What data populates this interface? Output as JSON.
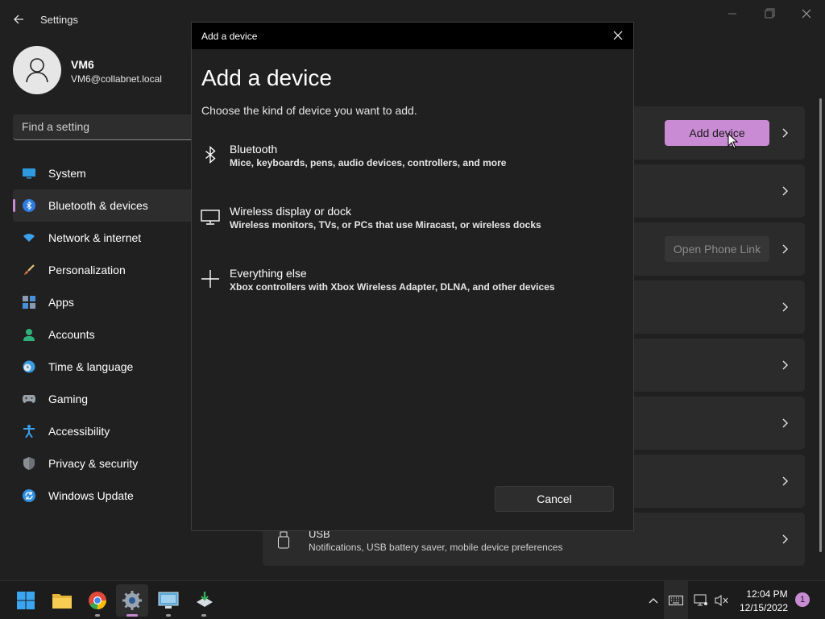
{
  "window": {
    "title": "Settings"
  },
  "profile": {
    "name": "VM6",
    "email": "VM6@collabnet.local"
  },
  "search": {
    "placeholder": "Find a setting"
  },
  "nav": {
    "items": [
      {
        "label": "System",
        "icon": "system-icon",
        "active": false
      },
      {
        "label": "Bluetooth & devices",
        "icon": "bluetooth-icon",
        "active": true
      },
      {
        "label": "Network & internet",
        "icon": "wifi-icon",
        "active": false
      },
      {
        "label": "Personalization",
        "icon": "brush-icon",
        "active": false
      },
      {
        "label": "Apps",
        "icon": "apps-icon",
        "active": false
      },
      {
        "label": "Accounts",
        "icon": "person-icon",
        "active": false
      },
      {
        "label": "Time & language",
        "icon": "clock-globe-icon",
        "active": false
      },
      {
        "label": "Gaming",
        "icon": "controller-icon",
        "active": false
      },
      {
        "label": "Accessibility",
        "icon": "accessibility-icon",
        "active": false
      },
      {
        "label": "Privacy & security",
        "icon": "shield-icon",
        "active": false
      },
      {
        "label": "Windows Update",
        "icon": "update-icon",
        "active": false
      }
    ]
  },
  "background": {
    "add_device_label": "Add device",
    "open_phone_link_label": "Open Phone Link",
    "usb_title": "USB",
    "usb_subtitle": "Notifications, USB battery saver, mobile device preferences"
  },
  "dialog": {
    "titlebar": "Add a device",
    "heading": "Add a device",
    "subtitle": "Choose the kind of device you want to add.",
    "options": [
      {
        "title": "Bluetooth",
        "description": "Mice, keyboards, pens, audio devices, controllers, and more",
        "icon": "bluetooth-icon"
      },
      {
        "title": "Wireless display or dock",
        "description": "Wireless monitors, TVs, or PCs that use Miracast, or wireless docks",
        "icon": "monitor-icon"
      },
      {
        "title": "Everything else",
        "description": "Xbox controllers with Xbox Wireless Adapter, DLNA, and other devices",
        "icon": "plus-icon"
      }
    ],
    "cancel_label": "Cancel"
  },
  "taskbar": {
    "time": "12:04 PM",
    "date": "12/15/2022",
    "notification_count": "1"
  },
  "colors": {
    "accent": "#c98bd4",
    "background": "#202020",
    "card": "#2b2b2b"
  }
}
